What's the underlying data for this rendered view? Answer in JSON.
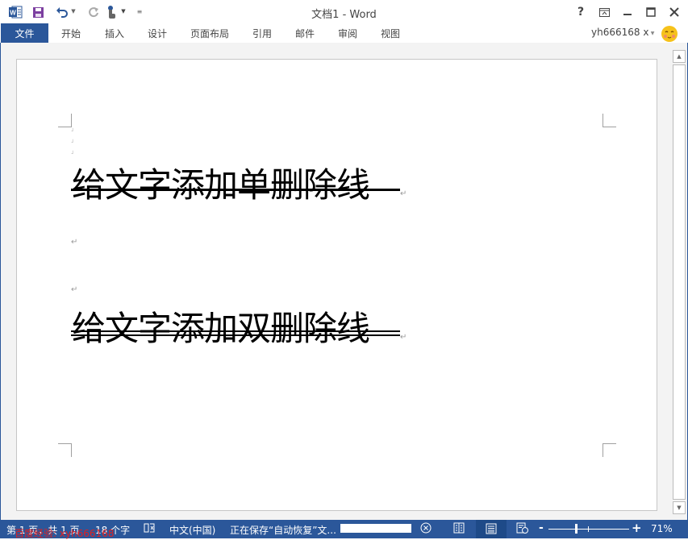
{
  "window": {
    "title": "文档1 - Word",
    "controls": {
      "help": "?",
      "ribbon_display": "ribbon-display-icon",
      "minimize": "minimize-icon",
      "maximize": "maximize-icon",
      "close": "close-icon"
    }
  },
  "quick_access": {
    "app_icon": "word-icon",
    "items": [
      "save-icon",
      "undo-icon",
      "redo-icon",
      "touch-mode-icon",
      "customize-icon"
    ]
  },
  "ribbon": {
    "file_tab": "文件",
    "tabs": [
      "开始",
      "插入",
      "设计",
      "页面布局",
      "引用",
      "邮件",
      "审阅",
      "视图"
    ],
    "user_name": "yh666168 x",
    "accent": "#2b579a"
  },
  "document": {
    "line1": "给文字添加单删除线",
    "line2": "给文字添加双删除线",
    "paragraph_mark": "↵"
  },
  "status_bar": {
    "page_info": "第 1 页，共 1 页",
    "word_count": "18 个字",
    "language": "中文(中国)",
    "saving_text": "正在保存“自动恢复”文...",
    "zoom_level": "71%",
    "zoom_minus": "-",
    "zoom_plus": "+",
    "save_progress": 1.0
  },
  "watermark": "百度经验: xyh666168"
}
